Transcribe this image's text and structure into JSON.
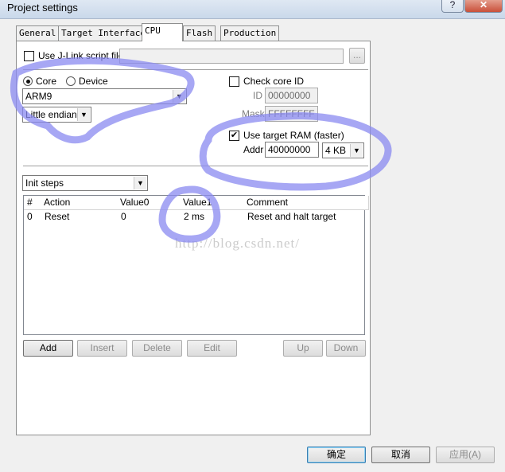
{
  "window": {
    "title": "Project settings",
    "help_label": "?",
    "close_label": "✕"
  },
  "tabs": [
    {
      "label": "General"
    },
    {
      "label": "Target Interface"
    },
    {
      "label": "CPU",
      "active": true
    },
    {
      "label": "Flash"
    },
    {
      "label": "Production"
    }
  ],
  "cpu": {
    "jlink_script": {
      "label": "Use J-Link script file",
      "checked": false,
      "value": "",
      "browse_label": "..."
    },
    "mode": {
      "core_label": "Core",
      "device_label": "Device",
      "selected": "Core"
    },
    "core_select": {
      "value": "ARM9"
    },
    "endian_select": {
      "value": "Little endian"
    },
    "check_core_id": {
      "label": "Check core ID",
      "checked": false,
      "id_label": "ID",
      "id_value": "00000000",
      "mask_label": "Mask",
      "mask_value": "FFFFFFFF"
    },
    "target_ram": {
      "label": "Use target RAM (faster)",
      "checked": true,
      "addr_label": "Addr",
      "addr_value": "40000000",
      "size_value": "4 KB"
    },
    "init_steps_select": {
      "value": "Init steps"
    },
    "table": {
      "columns": [
        "#",
        "Action",
        "Value0",
        "Value1",
        "Comment"
      ],
      "rows": [
        {
          "num": "0",
          "action": "Reset",
          "value0": "0",
          "value1": "2 ms",
          "comment": "Reset and halt target"
        }
      ]
    },
    "buttons": {
      "add": "Add",
      "insert": "Insert",
      "delete": "Delete",
      "edit": "Edit",
      "up": "Up",
      "down": "Down"
    }
  },
  "watermark": "http://blog.csdn.net/",
  "dialog_buttons": {
    "ok": "确定",
    "cancel": "取消",
    "apply": "应用(A)"
  },
  "colors": {
    "annotation": "#8a8af0",
    "close": "#c9503a"
  }
}
